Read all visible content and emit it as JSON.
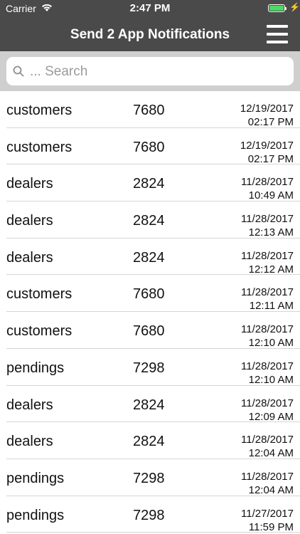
{
  "status_bar": {
    "carrier": "Carrier",
    "time": "2:47 PM"
  },
  "header": {
    "title": "Send 2 App Notifications",
    "menu_icon": "hamburger-menu-icon"
  },
  "search": {
    "placeholder": "... Search",
    "value": "",
    "icon": "search-icon"
  },
  "colors": {
    "header_bg": "#4a4a4a",
    "battery": "#4cd964",
    "search_bg": "#cfcfcf"
  },
  "rows": [
    {
      "name": "customers",
      "number": "7680",
      "date": "12/19/2017",
      "time": "02:17 PM"
    },
    {
      "name": "customers",
      "number": "7680",
      "date": "12/19/2017",
      "time": "02:17 PM"
    },
    {
      "name": "dealers",
      "number": "2824",
      "date": "11/28/2017",
      "time": "10:49 AM"
    },
    {
      "name": "dealers",
      "number": "2824",
      "date": "11/28/2017",
      "time": "12:13 AM"
    },
    {
      "name": "dealers",
      "number": "2824",
      "date": "11/28/2017",
      "time": "12:12 AM"
    },
    {
      "name": "customers",
      "number": "7680",
      "date": "11/28/2017",
      "time": "12:11 AM"
    },
    {
      "name": "customers",
      "number": "7680",
      "date": "11/28/2017",
      "time": "12:10 AM"
    },
    {
      "name": "pendings",
      "number": "7298",
      "date": "11/28/2017",
      "time": "12:10 AM"
    },
    {
      "name": "dealers",
      "number": "2824",
      "date": "11/28/2017",
      "time": "12:09 AM"
    },
    {
      "name": "dealers",
      "number": "2824",
      "date": "11/28/2017",
      "time": "12:04 AM"
    },
    {
      "name": "pendings",
      "number": "7298",
      "date": "11/28/2017",
      "time": "12:04 AM"
    },
    {
      "name": "pendings",
      "number": "7298",
      "date": "11/27/2017",
      "time": "11:59 PM"
    }
  ]
}
